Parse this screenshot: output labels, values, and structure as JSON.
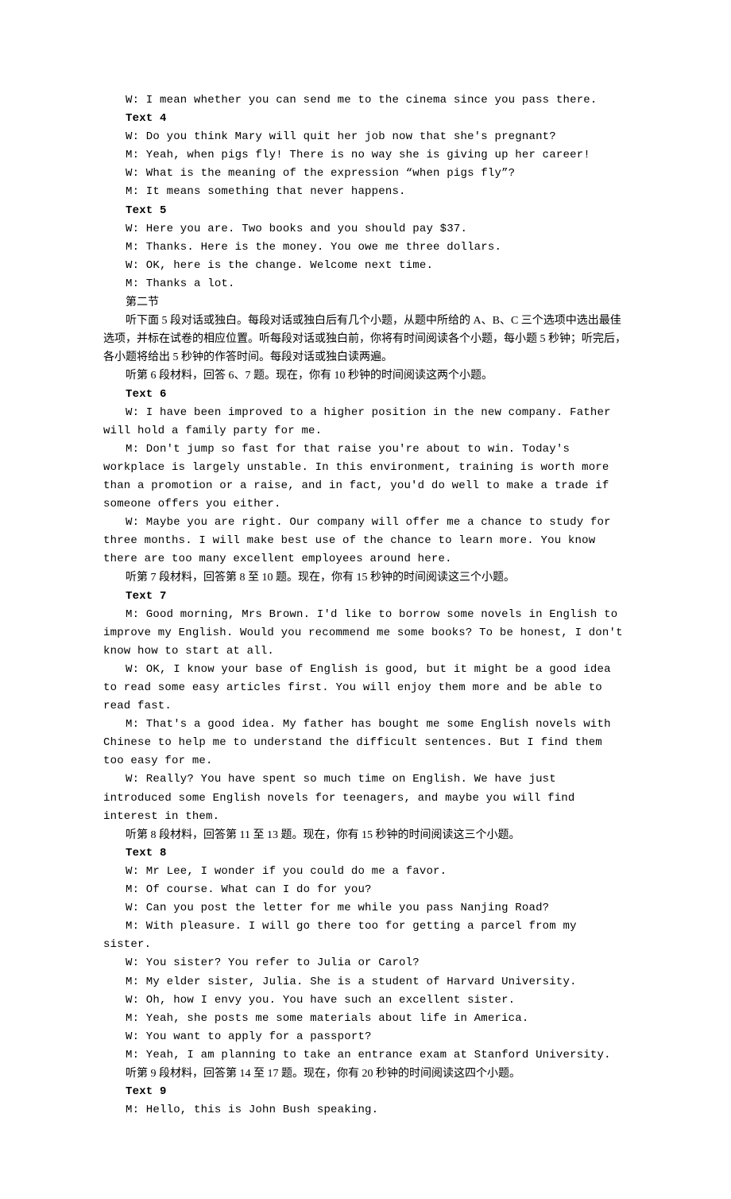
{
  "lines": [
    {
      "cls": "para mono",
      "bold": false,
      "text": "W: I mean whether you can send me to the cinema since you pass there."
    },
    {
      "cls": "para mono bold",
      "bold": true,
      "text": "Text 4"
    },
    {
      "cls": "para mono",
      "bold": false,
      "text": "W: Do you think Mary will quit her job now that she's pregnant?"
    },
    {
      "cls": "para mono",
      "bold": false,
      "text": "M: Yeah, when pigs fly! There is no way she is giving up her career!"
    },
    {
      "cls": "para mono",
      "bold": false,
      "text": "W: What is the meaning of the expression “when pigs fly”?"
    },
    {
      "cls": "para mono",
      "bold": false,
      "text": "M: It means something that never happens."
    },
    {
      "cls": "para mono bold",
      "bold": true,
      "text": "Text 5"
    },
    {
      "cls": "para mono",
      "bold": false,
      "text": "W: Here you are. Two books and you should pay $37."
    },
    {
      "cls": "para mono",
      "bold": false,
      "text": "M: Thanks. Here is the money. You owe me three dollars."
    },
    {
      "cls": "para mono",
      "bold": false,
      "text": "W: OK, here is the change. Welcome next time."
    },
    {
      "cls": "para mono",
      "bold": false,
      "text": "M: Thanks a lot."
    },
    {
      "cls": "para",
      "bold": false,
      "text": "第二节"
    },
    {
      "cls": "para",
      "bold": false,
      "text": "听下面 5 段对话或独白。每段对话或独白后有几个小题，从题中所给的 A、B、C 三个选项中选出最佳选项，并标在试卷的相应位置。听每段对话或独白前，你将有时间阅读各个小题，每小题 5 秒钟；听完后，各小题将给出 5 秒钟的作答时间。每段对话或独白读两遍。",
      "wrap": true
    },
    {
      "cls": "para",
      "bold": false,
      "text": "听第 6 段材料，回答 6、7 题。现在，你有 10 秒钟的时间阅读这两个小题。"
    },
    {
      "cls": "para mono bold",
      "bold": true,
      "text": "Text 6"
    },
    {
      "cls": "para mono",
      "bold": false,
      "text": "W: I have been improved to a higher position in the new company. Father will hold a family party for me.",
      "wrap": true
    },
    {
      "cls": "para mono",
      "bold": false,
      "text": "M: Don't jump so fast for that raise you're about to win. Today's workplace is largely unstable. In this environment, training is worth more than a promotion or a raise, and in fact, you'd do well to make a trade if someone offers you either.",
      "wrap": true
    },
    {
      "cls": "para mono",
      "bold": false,
      "text": "W: Maybe you are right. Our company will offer me a chance to study for three months. I will make best use of the chance to learn more. You know there are too many excellent employees around here.",
      "wrap": true
    },
    {
      "cls": "para",
      "bold": false,
      "text": "听第 7 段材料，回答第 8 至 10 题。现在，你有 15 秒钟的时间阅读这三个小题。"
    },
    {
      "cls": "para mono bold",
      "bold": true,
      "text": "Text 7"
    },
    {
      "cls": "para mono",
      "bold": false,
      "text": "M: Good morning, Mrs Brown. I'd like to borrow some novels in English to improve my English. Would you recommend me some books? To be honest, I don't know how to start at all.",
      "wrap": true
    },
    {
      "cls": "para mono",
      "bold": false,
      "text": "W: OK, I know your base of English is good, but it might be a good idea to read some easy articles first. You will enjoy them more and be able to read fast.",
      "wrap": true
    },
    {
      "cls": "para mono",
      "bold": false,
      "text": "M: That's a good idea. My father has bought me some English novels with Chinese to help me to understand the difficult sentences. But I find them too easy for me.",
      "wrap": true
    },
    {
      "cls": "para mono",
      "bold": false,
      "text": "W: Really? You have spent so much time on English. We have just introduced some English novels for teenagers, and maybe you will find interest in them.",
      "wrap": true
    },
    {
      "cls": "para",
      "bold": false,
      "text": "听第 8 段材料，回答第 11 至 13 题。现在，你有 15 秒钟的时间阅读这三个小题。"
    },
    {
      "cls": "para mono bold",
      "bold": true,
      "text": "Text 8"
    },
    {
      "cls": "para mono",
      "bold": false,
      "text": "W: Mr Lee, I wonder if you could do me a favor."
    },
    {
      "cls": "para mono",
      "bold": false,
      "text": "M: Of course. What can I do for you?"
    },
    {
      "cls": "para mono",
      "bold": false,
      "text": "W: Can you post the letter for me while you pass Nanjing Road?"
    },
    {
      "cls": "para mono",
      "bold": false,
      "text": "M: With pleasure. I will go there too for getting a parcel from my sister."
    },
    {
      "cls": "para mono",
      "bold": false,
      "text": "W: You sister? You refer to Julia or Carol?"
    },
    {
      "cls": "para mono",
      "bold": false,
      "text": "M: My elder sister, Julia. She is a student of Harvard University."
    },
    {
      "cls": "para mono",
      "bold": false,
      "text": "W: Oh, how I envy you. You have such an excellent sister."
    },
    {
      "cls": "para mono",
      "bold": false,
      "text": "M: Yeah, she posts me some materials about life in America."
    },
    {
      "cls": "para mono",
      "bold": false,
      "text": "W: You want to apply for a passport?"
    },
    {
      "cls": "para mono",
      "bold": false,
      "text": "M: Yeah, I am planning to take an entrance exam at Stanford University."
    },
    {
      "cls": "para",
      "bold": false,
      "text": "听第 9 段材料，回答第 14 至 17 题。现在，你有 20 秒钟的时间阅读这四个小题。"
    },
    {
      "cls": "para mono bold",
      "bold": true,
      "text": "Text 9"
    },
    {
      "cls": "para mono",
      "bold": false,
      "text": "M: Hello, this is John Bush speaking."
    }
  ]
}
